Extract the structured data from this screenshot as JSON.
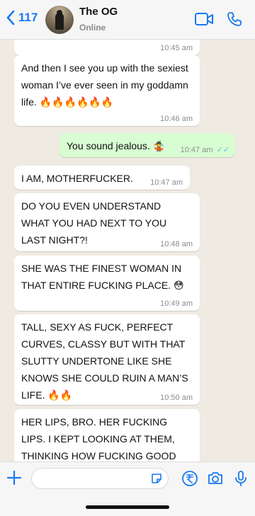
{
  "header": {
    "back_count": "117",
    "contact_name": "The OG",
    "status": "Online",
    "icons": [
      "back-chevron-icon",
      "video-call-icon",
      "phone-call-icon"
    ],
    "accent_color": "#1a78f2"
  },
  "messages": [
    {
      "direction": "in",
      "text": "",
      "time": "10:45 am"
    },
    {
      "direction": "in",
      "text": "And then I see you up with the sexiest woman I’ve ever seen in my goddamn life. 🔥🔥🔥🔥🔥🔥",
      "time": "10:46 am"
    },
    {
      "direction": "out",
      "text": "You sound jealous. 🤹",
      "time": "10:47 am",
      "read": "✓✓"
    },
    {
      "direction": "in",
      "text": "I AM, MOTHERFUCKER.",
      "time": "10:47 am"
    },
    {
      "direction": "in",
      "text": "DO YOU EVEN UNDERSTAND WHAT YOU HAD NEXT TO YOU LAST NIGHT?!",
      "time": "10:48 am"
    },
    {
      "direction": "in",
      "text": "SHE WAS THE FINEST WOMAN IN THAT ENTIRE FUCKING PLACE. 😳",
      "time": "10:49 am"
    },
    {
      "direction": "in",
      "text": "TALL, SEXY AS FUCK, PERFECT CURVES, CLASSY BUT WITH THAT SLUTTY UNDERTONE LIKE SHE KNOWS SHE COULD RUIN A MAN’S LIFE. 🔥🔥",
      "time": "10:50 am"
    },
    {
      "direction": "in",
      "text": "HER LIPS, BRO. HER FUCKING LIPS. I KEPT LOOKING AT THEM, THINKING HOW FUCKING GOOD",
      "time": ""
    }
  ],
  "input": {
    "placeholder": "",
    "icons": [
      "plus-icon",
      "sticker-icon",
      "payment-icon",
      "camera-icon",
      "microphone-icon"
    ]
  },
  "colors": {
    "chat_background": "#efeae2",
    "incoming_bubble": "#ffffff",
    "outgoing_bubble": "#d9fdd3",
    "read_ticks": "#53bdeb"
  }
}
